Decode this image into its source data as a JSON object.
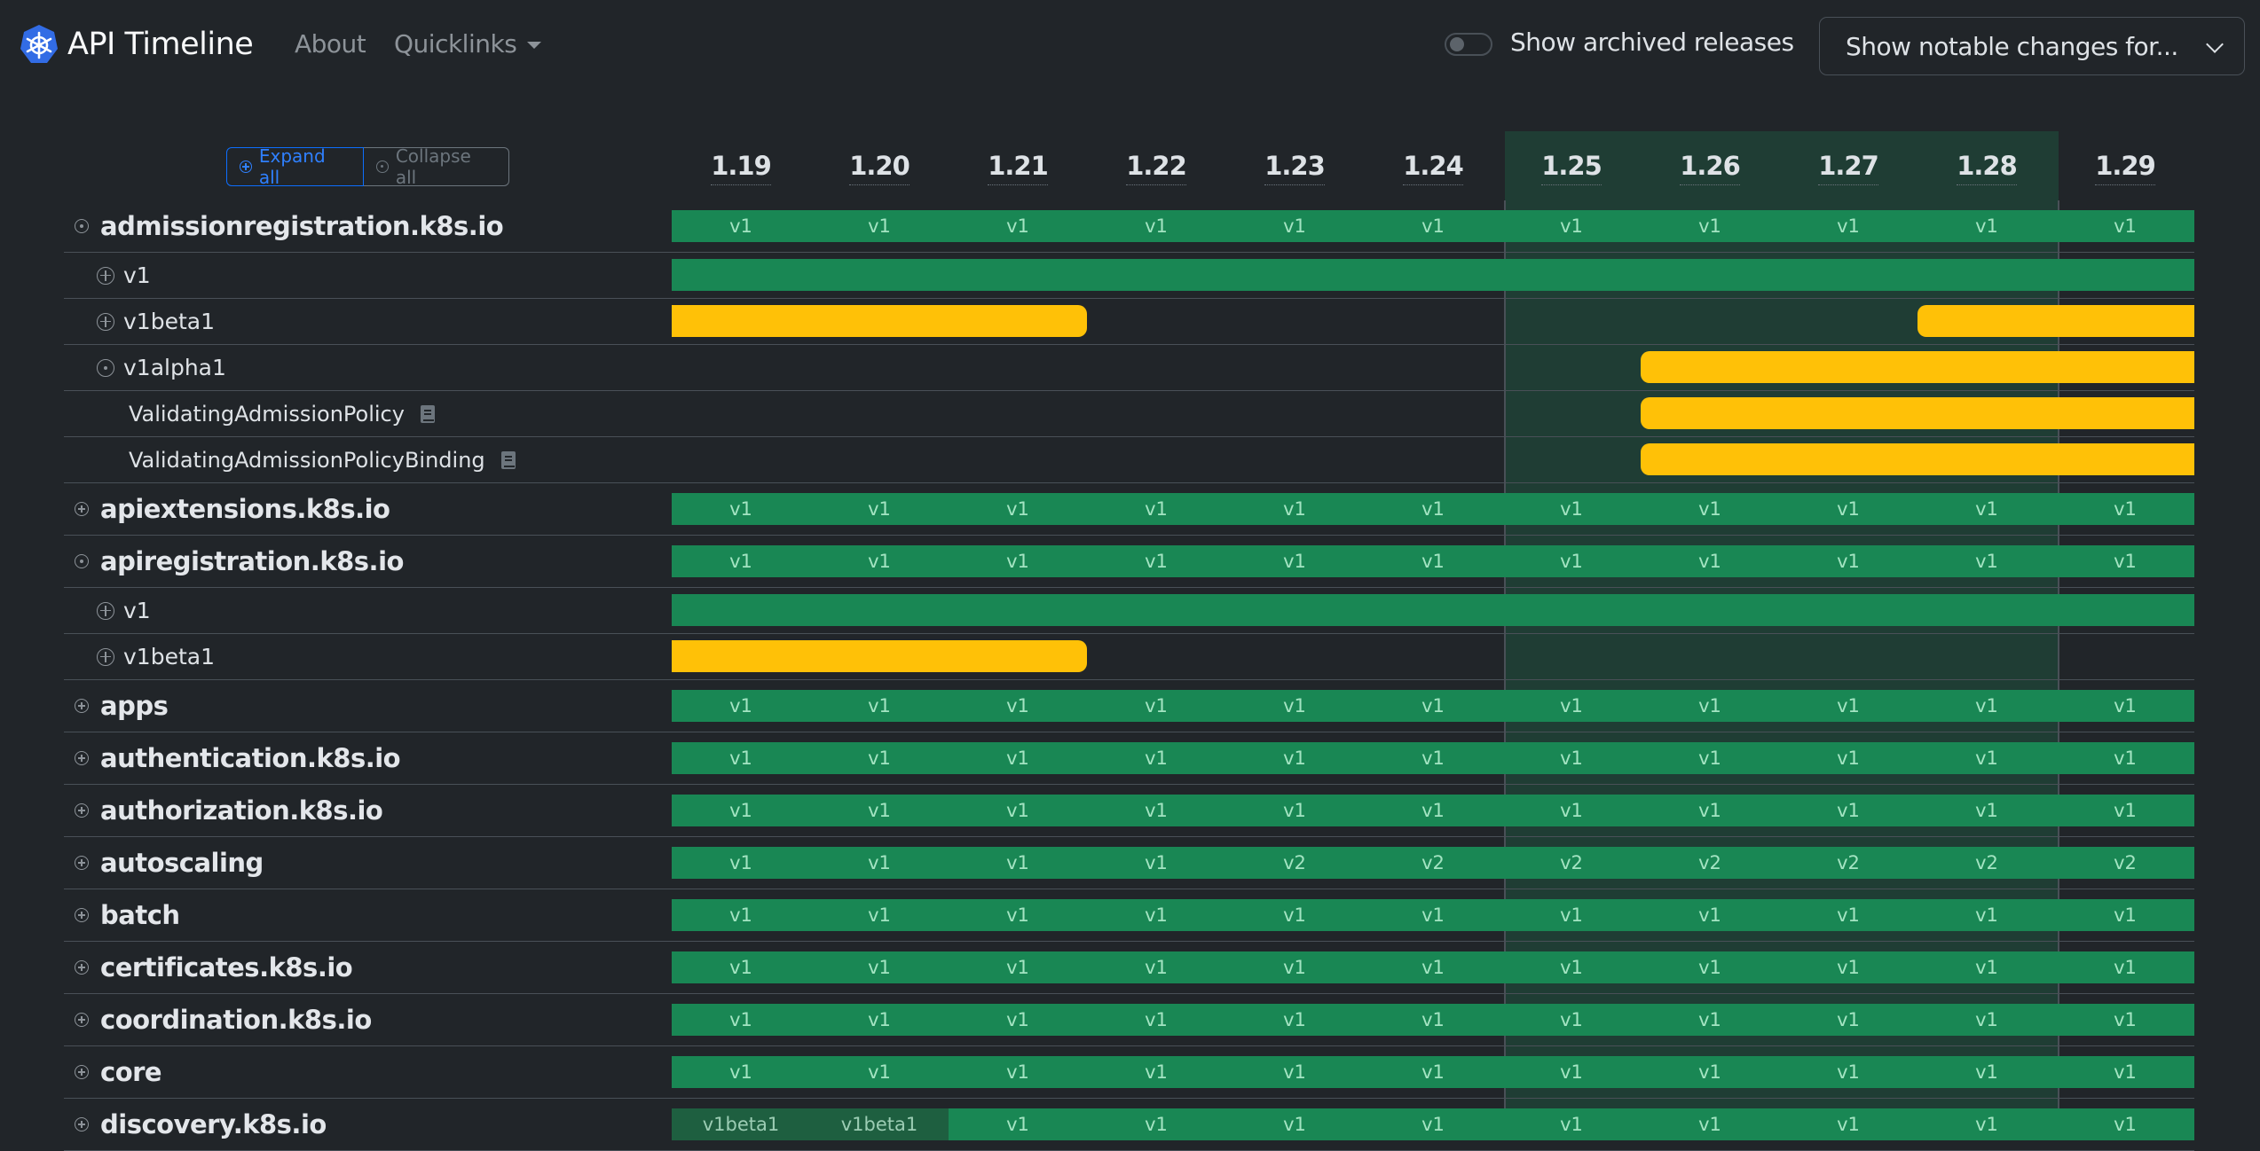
{
  "navbar": {
    "brand_title": "API Timeline",
    "about_label": "About",
    "quicklinks_label": "Quicklinks",
    "archived_toggle_label": "Show archived releases",
    "archived_toggle_on": false,
    "notable_select_value": "Show notable changes for..."
  },
  "controls": {
    "expand_all": "Expand all",
    "collapse_all": "Collapse all"
  },
  "colors": {
    "stable": "#198754",
    "beta": "#ffc107",
    "highlight": "#1f3d34",
    "primary": "#0d6efd"
  },
  "versions": [
    "1.19",
    "1.20",
    "1.21",
    "1.22",
    "1.23",
    "1.24",
    "1.25",
    "1.26",
    "1.27",
    "1.28",
    "1.29"
  ],
  "highlighted_versions": [
    "1.25",
    "1.26",
    "1.27",
    "1.28"
  ],
  "rows": [
    {
      "type": "group",
      "name": "admissionregistration.k8s.io",
      "expanded": true,
      "cells": [
        "v1",
        "v1",
        "v1",
        "v1",
        "v1",
        "v1",
        "v1",
        "v1",
        "v1",
        "v1",
        "v1"
      ]
    },
    {
      "type": "version",
      "name": "v1",
      "expanded": false,
      "bar": {
        "status": "stable",
        "from": "1.19",
        "to": "1.29"
      }
    },
    {
      "type": "version",
      "name": "v1beta1",
      "expanded": false,
      "bars": [
        {
          "status": "beta",
          "from": "1.19",
          "to": "1.21"
        },
        {
          "status": "beta",
          "from": "1.28",
          "to": "1.29"
        }
      ]
    },
    {
      "type": "version",
      "name": "v1alpha1",
      "expanded": true,
      "bar": {
        "status": "beta",
        "from": "1.26",
        "to": "1.29"
      }
    },
    {
      "type": "kind",
      "name": "ValidatingAdmissionPolicy",
      "bar": {
        "status": "beta",
        "from": "1.26",
        "to": "1.29"
      }
    },
    {
      "type": "kind",
      "name": "ValidatingAdmissionPolicyBinding",
      "bar": {
        "status": "beta",
        "from": "1.26",
        "to": "1.29"
      }
    },
    {
      "type": "group",
      "name": "apiextensions.k8s.io",
      "expanded": false,
      "cells": [
        "v1",
        "v1",
        "v1",
        "v1",
        "v1",
        "v1",
        "v1",
        "v1",
        "v1",
        "v1",
        "v1"
      ]
    },
    {
      "type": "group",
      "name": "apiregistration.k8s.io",
      "expanded": true,
      "cells": [
        "v1",
        "v1",
        "v1",
        "v1",
        "v1",
        "v1",
        "v1",
        "v1",
        "v1",
        "v1",
        "v1"
      ]
    },
    {
      "type": "version",
      "name": "v1",
      "expanded": false,
      "bar": {
        "status": "stable",
        "from": "1.19",
        "to": "1.29"
      }
    },
    {
      "type": "version",
      "name": "v1beta1",
      "expanded": false,
      "bar": {
        "status": "beta",
        "from": "1.19",
        "to": "1.21"
      }
    },
    {
      "type": "group",
      "name": "apps",
      "expanded": false,
      "cells": [
        "v1",
        "v1",
        "v1",
        "v1",
        "v1",
        "v1",
        "v1",
        "v1",
        "v1",
        "v1",
        "v1"
      ]
    },
    {
      "type": "group",
      "name": "authentication.k8s.io",
      "expanded": false,
      "cells": [
        "v1",
        "v1",
        "v1",
        "v1",
        "v1",
        "v1",
        "v1",
        "v1",
        "v1",
        "v1",
        "v1"
      ]
    },
    {
      "type": "group",
      "name": "authorization.k8s.io",
      "expanded": false,
      "cells": [
        "v1",
        "v1",
        "v1",
        "v1",
        "v1",
        "v1",
        "v1",
        "v1",
        "v1",
        "v1",
        "v1"
      ]
    },
    {
      "type": "group",
      "name": "autoscaling",
      "expanded": false,
      "cells": [
        "v1",
        "v1",
        "v1",
        "v1",
        "v2",
        "v2",
        "v2",
        "v2",
        "v2",
        "v2",
        "v2"
      ]
    },
    {
      "type": "group",
      "name": "batch",
      "expanded": false,
      "cells": [
        "v1",
        "v1",
        "v1",
        "v1",
        "v1",
        "v1",
        "v1",
        "v1",
        "v1",
        "v1",
        "v1"
      ]
    },
    {
      "type": "group",
      "name": "certificates.k8s.io",
      "expanded": false,
      "cells": [
        "v1",
        "v1",
        "v1",
        "v1",
        "v1",
        "v1",
        "v1",
        "v1",
        "v1",
        "v1",
        "v1"
      ]
    },
    {
      "type": "group",
      "name": "coordination.k8s.io",
      "expanded": false,
      "cells": [
        "v1",
        "v1",
        "v1",
        "v1",
        "v1",
        "v1",
        "v1",
        "v1",
        "v1",
        "v1",
        "v1"
      ]
    },
    {
      "type": "group",
      "name": "core",
      "expanded": false,
      "cells": [
        "v1",
        "v1",
        "v1",
        "v1",
        "v1",
        "v1",
        "v1",
        "v1",
        "v1",
        "v1",
        "v1"
      ]
    },
    {
      "type": "group",
      "name": "discovery.k8s.io",
      "expanded": false,
      "cells": [
        "v1beta1",
        "v1beta1",
        "v1",
        "v1",
        "v1",
        "v1",
        "v1",
        "v1",
        "v1",
        "v1",
        "v1"
      ]
    }
  ]
}
